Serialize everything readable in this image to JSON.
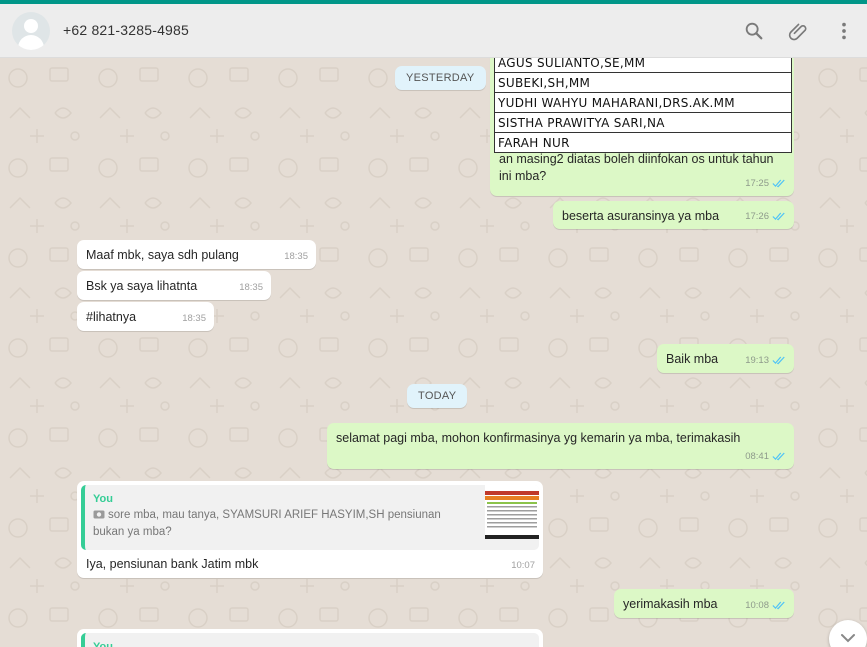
{
  "header": {
    "contact": "+62 821-3285-4985",
    "icons": [
      "search-icon",
      "attach-icon",
      "menu-icon"
    ]
  },
  "table_rows": [
    "AGUS SULIANTO,SE,MM",
    "SUBEKI,SH,MM",
    "YUDHI WAHYU MAHARANI,DRS.AK.MM",
    "SISTHA PRAWITYA SARI,NA",
    "FARAH NUR"
  ],
  "days": {
    "yesterday": "YESTERDAY",
    "today": "TODAY"
  },
  "messages": [
    {
      "text": "an masing2 diatas boleh diinfokan os untuk tahun ini mba?",
      "time": "17:25"
    },
    {
      "text": "beserta asuransinya ya mba",
      "time": "17:26"
    },
    {
      "text": "Maaf mbk, saya sdh pulang",
      "time": "18:35"
    },
    {
      "text": "Bsk ya saya lihatnta",
      "time": "18:35"
    },
    {
      "text": "#lihatnya",
      "time": "18:35"
    },
    {
      "text": "Baik mba",
      "time": "19:13"
    },
    {
      "text": "selamat pagi mba, mohon konfirmasinya yg kemarin ya mba, terimakasih",
      "time": "08:41"
    },
    {
      "text": "Iya, pensiunan bank Jatim mbk",
      "time": "10:07"
    },
    {
      "text": "yerimakasih mba",
      "time": "10:08"
    }
  ],
  "quote": {
    "author": "You",
    "text": "sore mba, mau tanya, SYAMSURI ARIEF HASYIM,SH pensiunan bukan ya mba?"
  },
  "quote2": {
    "author": "You"
  },
  "colors": {
    "accent": "#009688",
    "outgoing": "#dcf8c6",
    "incoming": "#ffffff",
    "tick": "#4fc3f7",
    "quote_bar": "#35cd96"
  }
}
